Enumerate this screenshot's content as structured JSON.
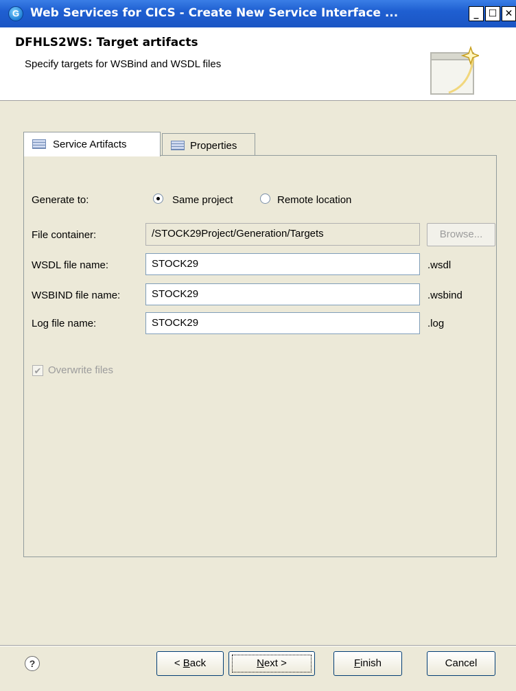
{
  "window": {
    "title": "Web Services for CICS - Create New Service Interface ...",
    "icon": "cics-web-services-icon",
    "minimize_label": "_",
    "maximize_label": "☐",
    "close_label": "✕"
  },
  "header": {
    "title": "DFHLS2WS: Target artifacts",
    "description": "Specify targets for WSBind and WSDL files",
    "graphic": "wizard-banner-icon"
  },
  "tabs": [
    {
      "label": "Service Artifacts",
      "selected": true,
      "icon": "table-icon"
    },
    {
      "label": "Properties",
      "selected": false,
      "icon": "table-icon"
    }
  ],
  "form": {
    "generate_to": {
      "label": "Generate to:",
      "options": [
        {
          "label": "Same project",
          "selected": true
        },
        {
          "label": "Remote location",
          "selected": false
        }
      ]
    },
    "file_container": {
      "label": "File container:",
      "value": "/STOCK29Project/Generation/Targets",
      "enabled": false
    },
    "browse_label": "Browse...",
    "wsdl": {
      "label": "WSDL file name:",
      "value": "STOCK29",
      "suffix": ".wsdl"
    },
    "wsbind": {
      "label": "WSBIND file name:",
      "value": "STOCK29",
      "suffix": ".wsbind"
    },
    "log": {
      "label": "Log file name:",
      "value": "STOCK29",
      "suffix": ".log"
    },
    "overwrite": {
      "label": "Overwrite files",
      "checked": true,
      "enabled": false
    }
  },
  "buttons": {
    "help": "?",
    "back_prefix": "< ",
    "back_mnemonic": "B",
    "back_rest": "ack",
    "next_mnemonic": "N",
    "next_rest": "ext >",
    "finish_mnemonic": "F",
    "finish_rest": "inish",
    "cancel": "Cancel"
  },
  "colors": {
    "title_bar": "#1f5fd1",
    "dialog_bg": "#ece9d8",
    "header_bg": "#ffffff"
  }
}
